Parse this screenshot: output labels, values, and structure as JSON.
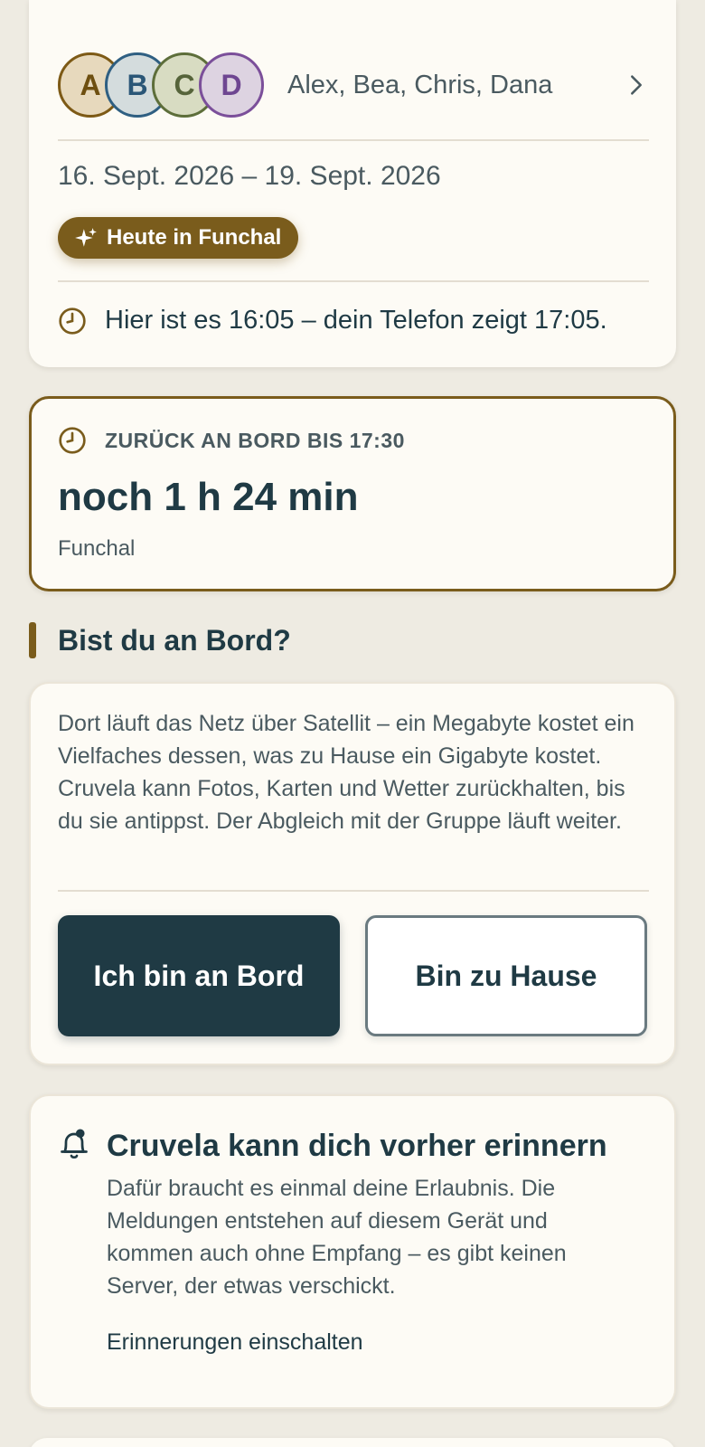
{
  "trip": {
    "members": [
      {
        "initial": "A",
        "name": "Alex"
      },
      {
        "initial": "B",
        "name": "Bea"
      },
      {
        "initial": "C",
        "name": "Chris"
      },
      {
        "initial": "D",
        "name": "Dana"
      }
    ],
    "member_names": "Alex, Bea, Chris, Dana",
    "dates": "16. Sept. 2026 – 19. Sept. 2026",
    "today_label": "Heute in Funchal",
    "time_note": "Hier ist es 16:05 – dein Telefon zeigt 17:05."
  },
  "boarding": {
    "label": "ZURÜCK AN BORD BIS 17:30",
    "countdown": "noch 1 h 24 min",
    "port": "Funchal"
  },
  "onboard_question": {
    "title": "Bist du an Bord?",
    "text": "Dort läuft das Netz über Satellit – ein Megabyte kostet ein Vielfaches dessen, was zu Hause ein Gigabyte kostet. Cruvela kann Fotos, Karten und Wetter zurückhalten, bis du sie antippst. Der Abgleich mit der Gruppe läuft weiter.",
    "primary_button": "Ich bin an Bord",
    "secondary_button": "Bin zu Hause"
  },
  "reminder": {
    "title": "Cruvela kann dich vorher erinnern",
    "text": "Dafür braucht es einmal deine Erlaubnis. Die Meldungen entstehen auf diesem Gerät und kommen auch ohne Empfang – es gibt keinen Server, der etwas verschickt.",
    "link": "Erinnerungen einschalten"
  },
  "colors": {
    "accent": "#7a5c1c",
    "primary": "#1f3a44",
    "background": "#eeebe2",
    "card": "#fdfbf5"
  }
}
